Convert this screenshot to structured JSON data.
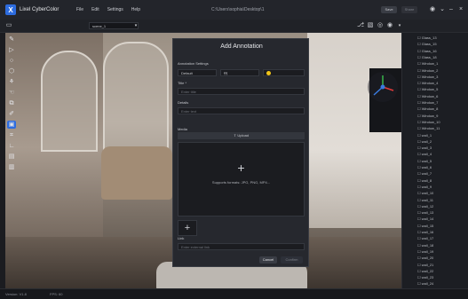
{
  "app": {
    "name": "Lixel CyberColor",
    "logo_letter": "X",
    "menu": [
      "File",
      "Edit",
      "Settings",
      "Help"
    ],
    "window_path": "C:\\Users\\sophia\\Desktop\\1",
    "save_label": "Save",
    "share_label": "Share"
  },
  "toolbar2": {
    "scene_select": "scene_1"
  },
  "left_tools": [
    {
      "icon": "brush-icon",
      "glyph": "✎"
    },
    {
      "icon": "expand-icon",
      "glyph": "▷"
    },
    {
      "icon": "circle-icon",
      "glyph": "○"
    },
    {
      "icon": "cube-icon",
      "glyph": "⬡"
    },
    {
      "icon": "chart-icon",
      "glyph": "⚘"
    },
    {
      "icon": "hand-icon",
      "glyph": "☜"
    },
    {
      "icon": "copy-icon",
      "glyph": "⧉"
    },
    {
      "icon": "edit-icon",
      "glyph": "✐"
    },
    {
      "icon": "annotation-icon",
      "glyph": "▣"
    },
    {
      "icon": "measure-icon",
      "glyph": "⌗"
    },
    {
      "icon": "angle-icon",
      "glyph": "∟"
    },
    {
      "icon": "file-icon",
      "glyph": "▤"
    },
    {
      "icon": "document-icon",
      "glyph": "▥"
    }
  ],
  "modal": {
    "title": "Add Annotation",
    "settings_label": "Annotation Settings",
    "style_value": "Default",
    "font_value": "¶¶",
    "title_label": "Title *",
    "title_placeholder": "Enter title",
    "details_label": "Details",
    "details_placeholder": "Enter text",
    "media_label": "Media",
    "upload_label": "Upload",
    "dropzone_text": "Supports formats: JPG, PNG, MP4...",
    "link_label": "Link",
    "link_placeholder": "Enter external link",
    "cancel_label": "Cancel",
    "confirm_label": "Confirm",
    "dot_color": "#f0c419"
  },
  "right_panel": {
    "items": [
      "Glass_13",
      "Glass_15",
      "Glass_16",
      "Glass_18",
      "Window_1",
      "Window_2",
      "Window_3",
      "Window_4",
      "Window_5",
      "Window_6",
      "Window_7",
      "Window_8",
      "Window_9",
      "Window_10",
      "Window_11",
      "wall_1",
      "wall_2",
      "wall_3",
      "wall_4",
      "wall_5",
      "wall_6",
      "wall_7",
      "wall_8",
      "wall_9",
      "wall_10",
      "wall_11",
      "wall_12",
      "wall_13",
      "wall_14",
      "wall_15",
      "wall_16",
      "wall_17",
      "wall_18",
      "wall_19",
      "wall_20",
      "wall_21",
      "wall_22",
      "wall_23",
      "wall_24"
    ]
  },
  "status": {
    "version": "Version: V1.8",
    "fps": "FPS: 60"
  }
}
